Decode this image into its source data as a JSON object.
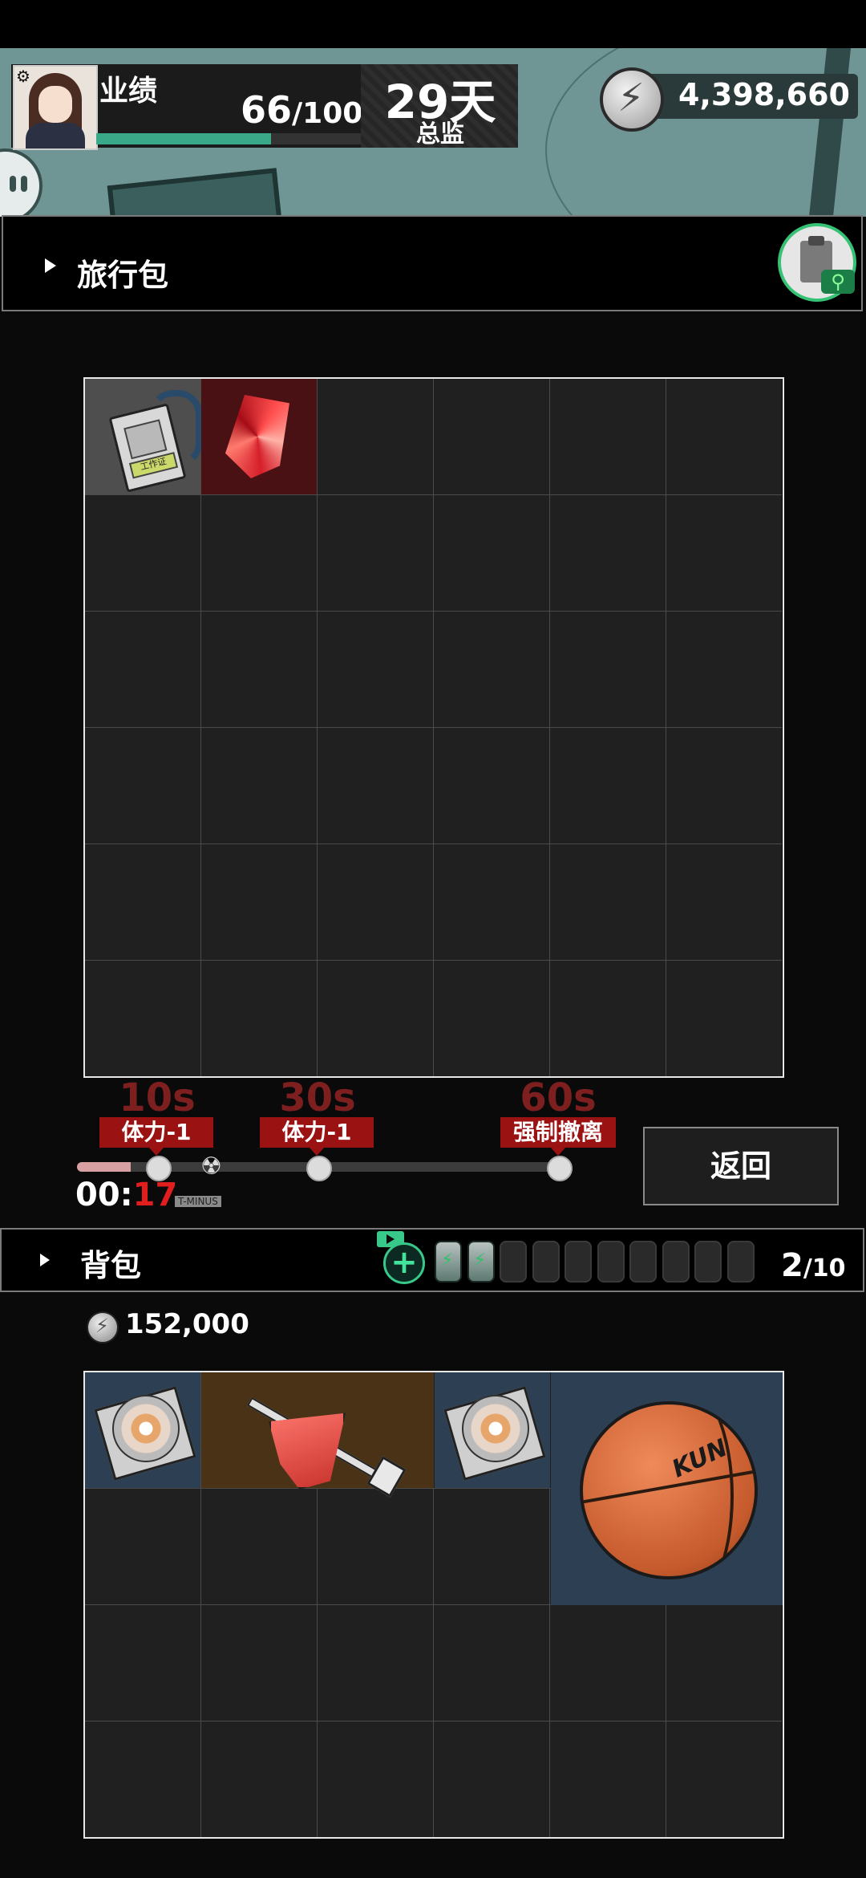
{
  "header": {
    "performance_label": "业绩",
    "performance_value": "66",
    "performance_max": "/100",
    "performance_fraction": 0.66,
    "days": "29天",
    "rank": "总监",
    "coins": "4,398,660"
  },
  "travel_bag": {
    "title": "旅行包",
    "items": [
      {
        "name": "work-badge",
        "label": "工作证"
      },
      {
        "name": "red-crystal"
      }
    ]
  },
  "timeline": {
    "milestones": [
      {
        "time": "10s",
        "effect": "体力-1"
      },
      {
        "time": "30s",
        "effect": "体力-1"
      },
      {
        "time": "60s",
        "effect": "强制撤离"
      }
    ],
    "progress_fraction": 0.11,
    "timer_prefix": "00:",
    "timer_seconds": "17",
    "tminus_label": "T-MINUS",
    "return_label": "返回"
  },
  "backpack": {
    "title": "背包",
    "capacity_used": "2",
    "capacity_max": "/10",
    "coins": "152,000",
    "items": [
      {
        "name": "disc-case"
      },
      {
        "name": "gem-with-shovel"
      },
      {
        "name": "disc-case"
      },
      {
        "name": "basketball",
        "logo": "KUN"
      }
    ]
  },
  "colors": {
    "accent_green": "#37c88a",
    "warning_red": "#9b1212",
    "timer_red": "#e01e1e"
  }
}
